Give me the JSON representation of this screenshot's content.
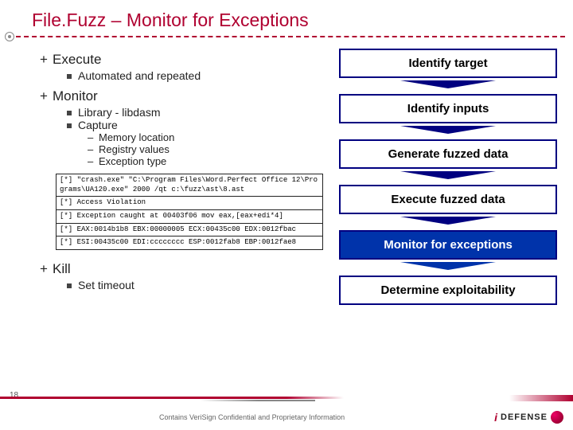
{
  "title": "File.Fuzz – Monitor for Exceptions",
  "content": {
    "items": [
      {
        "label": "Execute",
        "subs": [
          {
            "label": "Automated and repeated"
          }
        ]
      },
      {
        "label": "Monitor",
        "subs": [
          {
            "label": "Library - libdasm"
          },
          {
            "label": "Capture",
            "subs2": [
              {
                "label": "Memory location"
              },
              {
                "label": "Registry values"
              },
              {
                "label": "Exception type"
              }
            ]
          }
        ]
      },
      {
        "label": "Kill",
        "subs": [
          {
            "label": "Set timeout"
          }
        ]
      }
    ]
  },
  "code": {
    "l0": "[*] \"crash.exe\" \"C:\\Program Files\\Word.Perfect Office 12\\Programs\\UA120.exe\" 2000 /qt c:\\fuzz\\ast\\8.ast",
    "l1": "[*] Access Violation",
    "l2": "[*] Exception caught at 00403f06 mov eax,[eax+edi*4]",
    "l3": "[*] EAX:0014b1b8 EBX:00000005 ECX:00435c00 EDX:0012fbac",
    "l4": "[*] ESI:00435c00 EDI:cccccccc ESP:0012fab8 EBP:0012fae8"
  },
  "steps": {
    "s0": "Identify target",
    "s1": "Identify inputs",
    "s2": "Generate fuzzed data",
    "s3": "Execute fuzzed data",
    "s4": "Monitor for exceptions",
    "s5": "Determine exploitability"
  },
  "footer": {
    "page": "18",
    "confidential": "Contains VeriSign Confidential and Proprietary Information",
    "logo": "DEFENSE"
  }
}
